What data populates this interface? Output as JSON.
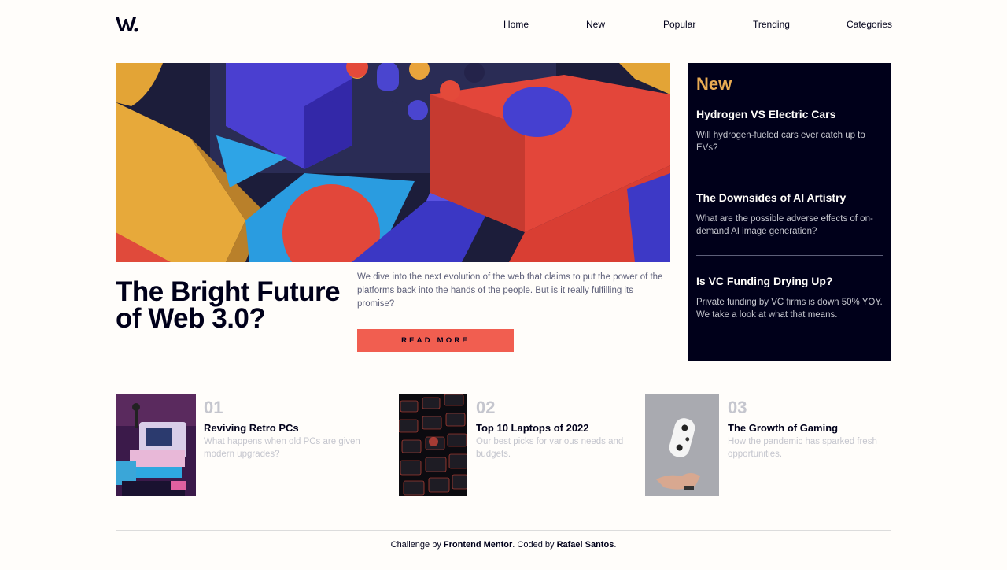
{
  "header": {
    "logo_alt": "W.",
    "nav": [
      {
        "label": "Home"
      },
      {
        "label": "New"
      },
      {
        "label": "Popular"
      },
      {
        "label": "Trending"
      },
      {
        "label": "Categories"
      }
    ]
  },
  "hero": {
    "title": "The Bright Future of Web 3.0?",
    "lead": "We dive into the next evolution of the web that claims to put the power of the platforms back into the hands of the people. But is it really fulfilling its promise?",
    "button": "READ MORE"
  },
  "new_panel": {
    "title": "New",
    "items": [
      {
        "title": "Hydrogen VS Electric Cars",
        "desc": "Will hydrogen-fueled cars ever catch up to EVs?"
      },
      {
        "title": "The Downsides of AI Artistry",
        "desc": "What are the possible adverse effects of on-demand AI image generation?"
      },
      {
        "title": "Is VC Funding Drying Up?",
        "desc": "Private funding by VC firms is down 50% YOY. We take a look at what that means."
      }
    ]
  },
  "articles": [
    {
      "num": "01",
      "title": "Reviving Retro PCs",
      "desc": "What happens when old PCs are given modern upgrades?"
    },
    {
      "num": "02",
      "title": "Top 10 Laptops of 2022",
      "desc": "Our best picks for various needs and budgets."
    },
    {
      "num": "03",
      "title": "The Growth of Gaming",
      "desc": "How the pandemic has sparked fresh opportunities."
    }
  ],
  "footer": {
    "prefix": "Challenge by ",
    "mentor": "Frontend Mentor",
    "middle": ". Coded by ",
    "author": "Rafael Santos",
    "suffix": "."
  },
  "colors": {
    "accent": "#f15e50",
    "panel_bg": "#00001a",
    "panel_title": "#e9ab53",
    "muted": "#c5c6ce",
    "body_text": "#5d5f79"
  }
}
